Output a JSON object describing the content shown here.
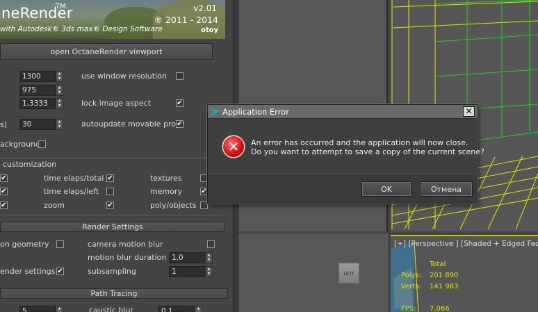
{
  "banner": {
    "title": "neRender",
    "tm": "TM",
    "subtitle": "with Autodesk® 3ds max® Design Software",
    "version": "v2.01",
    "copyright": "® 2011 - 2014",
    "brand": "otoy"
  },
  "open_viewport_label": "open OctaneRender viewport",
  "settings": {
    "width_value": "1300",
    "height_value": "975",
    "aspect_value": "1,3333",
    "fps_value": "30",
    "fps_prefix": "s)",
    "use_window_resolution": "use window resolution",
    "lock_image_aspect": "lock image aspect",
    "autoupdate_proxy": "autoupdate movable proxy",
    "background_label": "ackground",
    "customization_label": "customization",
    "time_elaps_total": "time elaps/total",
    "time_elaps_left": "time elaps/left",
    "zoom": "zoom",
    "textures": "textures",
    "memory": "memory",
    "poly_objects": "poly/objects"
  },
  "render_settings": {
    "header": "Render Settings",
    "on_geometry": "on geometry",
    "camera_motion_blur": "camera motion blur",
    "motion_blur_duration": "motion blur duration",
    "motion_blur_value": "1,0",
    "ender_settings": "ender settings",
    "subsampling": "subsampling",
    "subsampling_value": "1"
  },
  "path_tracing": {
    "header": "Path Tracing",
    "left_value": "5",
    "caustic_blur": "caustic blur",
    "caustic_value": "0,1"
  },
  "checkmark": "✔",
  "dialog": {
    "title": "Application Error",
    "close_glyph": "✕",
    "error_glyph": "✕",
    "message_line1": "An error has occurred and the application will now close.",
    "message_line2": "Do you want to attempt to save a copy of the current scene?",
    "ok_label": "OK",
    "cancel_label": "Отмена"
  },
  "viewport": {
    "label": "[+] [Perspective ] [Shaded + Edged Faces",
    "total_label": "Total",
    "polys_label": "Polys:",
    "polys_value": "201 890",
    "verts_label": "Verts:",
    "verts_value": "141 983",
    "fps_label": "FPS:",
    "fps_value": "7,066"
  },
  "cube_label": "ЦПТ",
  "colors": {
    "wireframe": "#e6e600",
    "green_object": "#1fd11f",
    "error_red": "#d40000"
  }
}
